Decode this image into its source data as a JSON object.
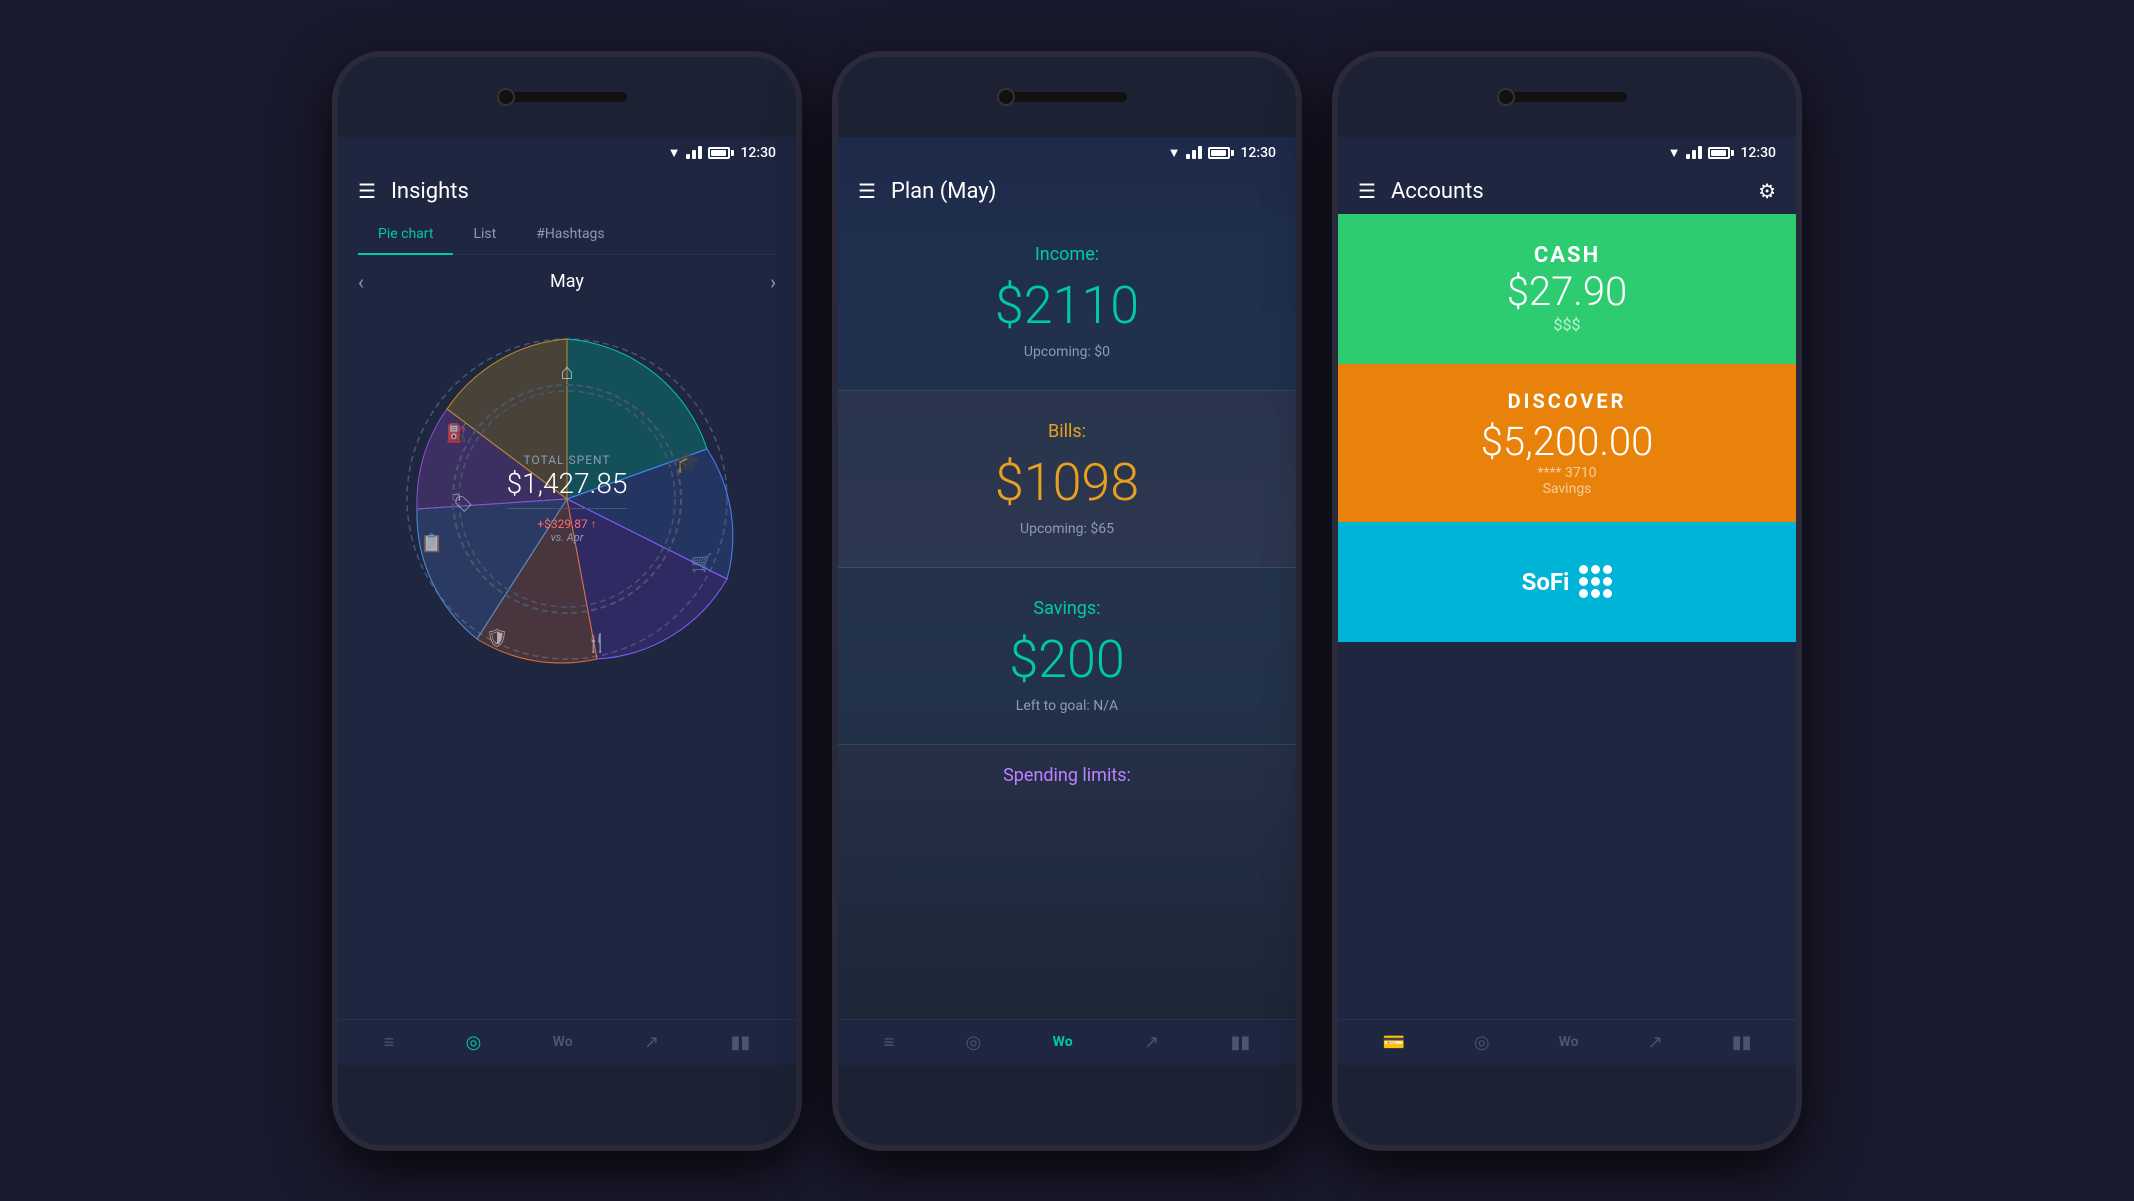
{
  "phones": [
    {
      "id": "insights",
      "statusBar": {
        "time": "12:30"
      },
      "header": {
        "title": "Insights",
        "menuIcon": "☰"
      },
      "tabs": [
        {
          "label": "Pie chart",
          "active": true
        },
        {
          "label": "List",
          "active": false
        },
        {
          "label": "#Hashtags",
          "active": false
        }
      ],
      "monthNav": {
        "prev": "‹",
        "month": "May",
        "next": "›"
      },
      "pie": {
        "label": "TOTAL SPENT",
        "amount": "$1,427.85",
        "change": "+$329.87 ↑",
        "vsLabel": "vs. Apr"
      },
      "bottomNav": [
        {
          "icon": "≡",
          "active": false
        },
        {
          "icon": "◎",
          "active": true
        },
        {
          "icon": "W",
          "active": false
        },
        {
          "icon": "↗",
          "active": false
        },
        {
          "icon": "▮▮",
          "active": false
        }
      ]
    },
    {
      "id": "plan",
      "statusBar": {
        "time": "12:30"
      },
      "header": {
        "title": "Plan (May)",
        "menuIcon": "☰"
      },
      "sections": [
        {
          "label": "Income:",
          "amount": "$2110",
          "upcoming": "Upcoming: $0",
          "colorClass": "income"
        },
        {
          "label": "Bills:",
          "amount": "$1098",
          "upcoming": "Upcoming: $65",
          "colorClass": "bills"
        },
        {
          "label": "Savings:",
          "amount": "$200",
          "upcoming": "Left to goal: N/A",
          "colorClass": "savings"
        }
      ],
      "spendingLabel": "Spending limits:",
      "bottomNav": [
        {
          "icon": "≡",
          "active": false
        },
        {
          "icon": "◎",
          "active": false
        },
        {
          "icon": "W",
          "active": true
        },
        {
          "icon": "↗",
          "active": false
        },
        {
          "icon": "▮▮",
          "active": false
        }
      ]
    },
    {
      "id": "accounts",
      "statusBar": {
        "time": "12:30"
      },
      "header": {
        "title": "Accounts",
        "menuIcon": "☰",
        "gearIcon": "⚙"
      },
      "accounts": [
        {
          "type": "cash",
          "name": "CASH",
          "balance": "$27.90",
          "sub": "$$$",
          "colorClass": "card-cash"
        },
        {
          "type": "discover",
          "name": "DISCOVER",
          "balance": "$5,200.00",
          "cardNum": "**** 3710",
          "sub": "Savings",
          "colorClass": "card-discover"
        },
        {
          "type": "sofi",
          "name": "SoFi",
          "colorClass": "card-sofi"
        }
      ],
      "bottomNav": [
        {
          "icon": "💳",
          "active": true
        },
        {
          "icon": "◎",
          "active": false
        },
        {
          "icon": "W",
          "active": false
        },
        {
          "icon": "↗",
          "active": false
        },
        {
          "icon": "▮▮",
          "active": false
        }
      ]
    }
  ]
}
